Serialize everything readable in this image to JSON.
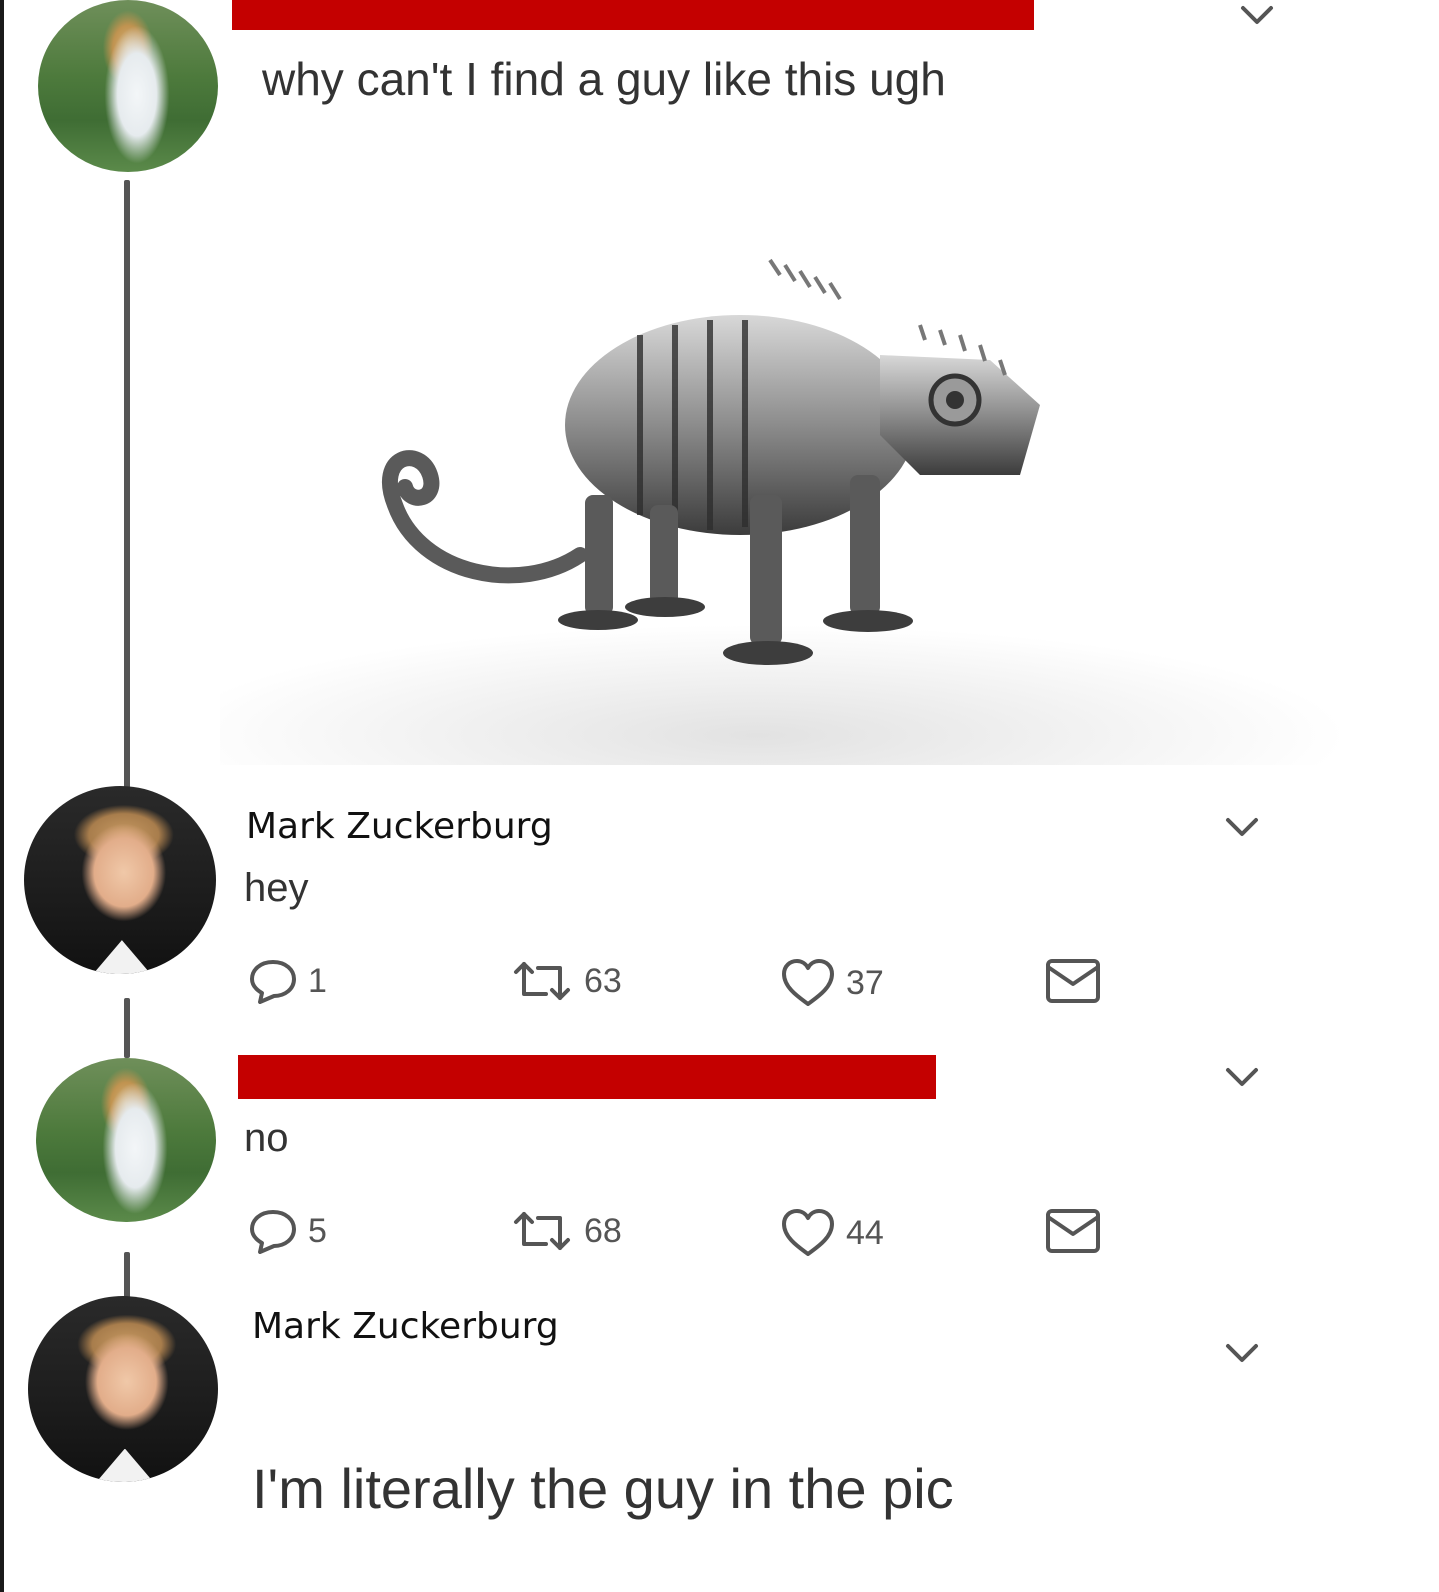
{
  "tweets": [
    {
      "text": "why can't I find a guy like this ugh",
      "avatar": "woman-avatar",
      "name_redacted": true,
      "image": "robot-chameleon"
    },
    {
      "name": "Mark Zuckerburg",
      "text": "hey",
      "avatar": "zuckerberg-avatar",
      "actions": {
        "replies": "1",
        "retweets": "63",
        "likes": "37"
      }
    },
    {
      "text": "no",
      "avatar": "woman-avatar",
      "name_redacted": true,
      "actions": {
        "replies": "5",
        "retweets": "68",
        "likes": "44"
      }
    },
    {
      "name": "Mark Zuckerburg",
      "text": "I'm literally the guy in the pic",
      "avatar": "zuckerberg-avatar"
    }
  ],
  "colors": {
    "redaction": "#c40000",
    "thread_line": "#555555",
    "icon": "#555555"
  },
  "icons": [
    "chevron-down-icon",
    "reply-icon",
    "retweet-icon",
    "like-icon",
    "message-icon"
  ]
}
